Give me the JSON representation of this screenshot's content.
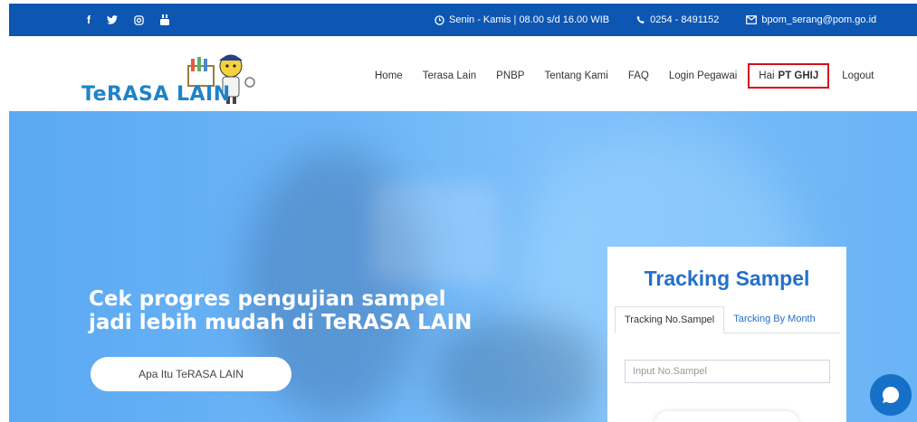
{
  "topbar": {
    "social": [
      {
        "name": "facebook-icon",
        "glyph": "f"
      },
      {
        "name": "twitter-icon",
        "glyph": "✦"
      },
      {
        "name": "instagram-icon",
        "glyph": "◎"
      },
      {
        "name": "youtube-icon",
        "glyph": "▶"
      }
    ],
    "hours": "Senin - Kamis | 08.00 s/d 16.00 WIB",
    "phone": "0254 - 8491152",
    "email": "bpom_serang@pom.go.id"
  },
  "logo": {
    "text": "TeRASA LAIN"
  },
  "nav": {
    "items": [
      "Home",
      "Terasa Lain",
      "PNBP",
      "Tentang Kami",
      "FAQ",
      "Login Pegawai"
    ],
    "greeting_prefix": "Hai",
    "greeting_user": "PT GHIJ",
    "logout": "Logout"
  },
  "hero": {
    "title_line1": "Cek progres pengujian sampel",
    "title_line2": "jadi lebih mudah di TeRASA LAIN",
    "button": "Apa Itu TeRASA LAIN"
  },
  "tracking": {
    "title": "Tracking Sampel",
    "tabs": [
      "Tracking No.Sampel",
      "Tarcking By Month"
    ],
    "input_placeholder": "Input No.Sampel"
  },
  "colors": {
    "topbar": "#0d57b3",
    "accent": "#2470c9",
    "highlight_border": "#d40f1c",
    "chat": "#1670c8"
  }
}
